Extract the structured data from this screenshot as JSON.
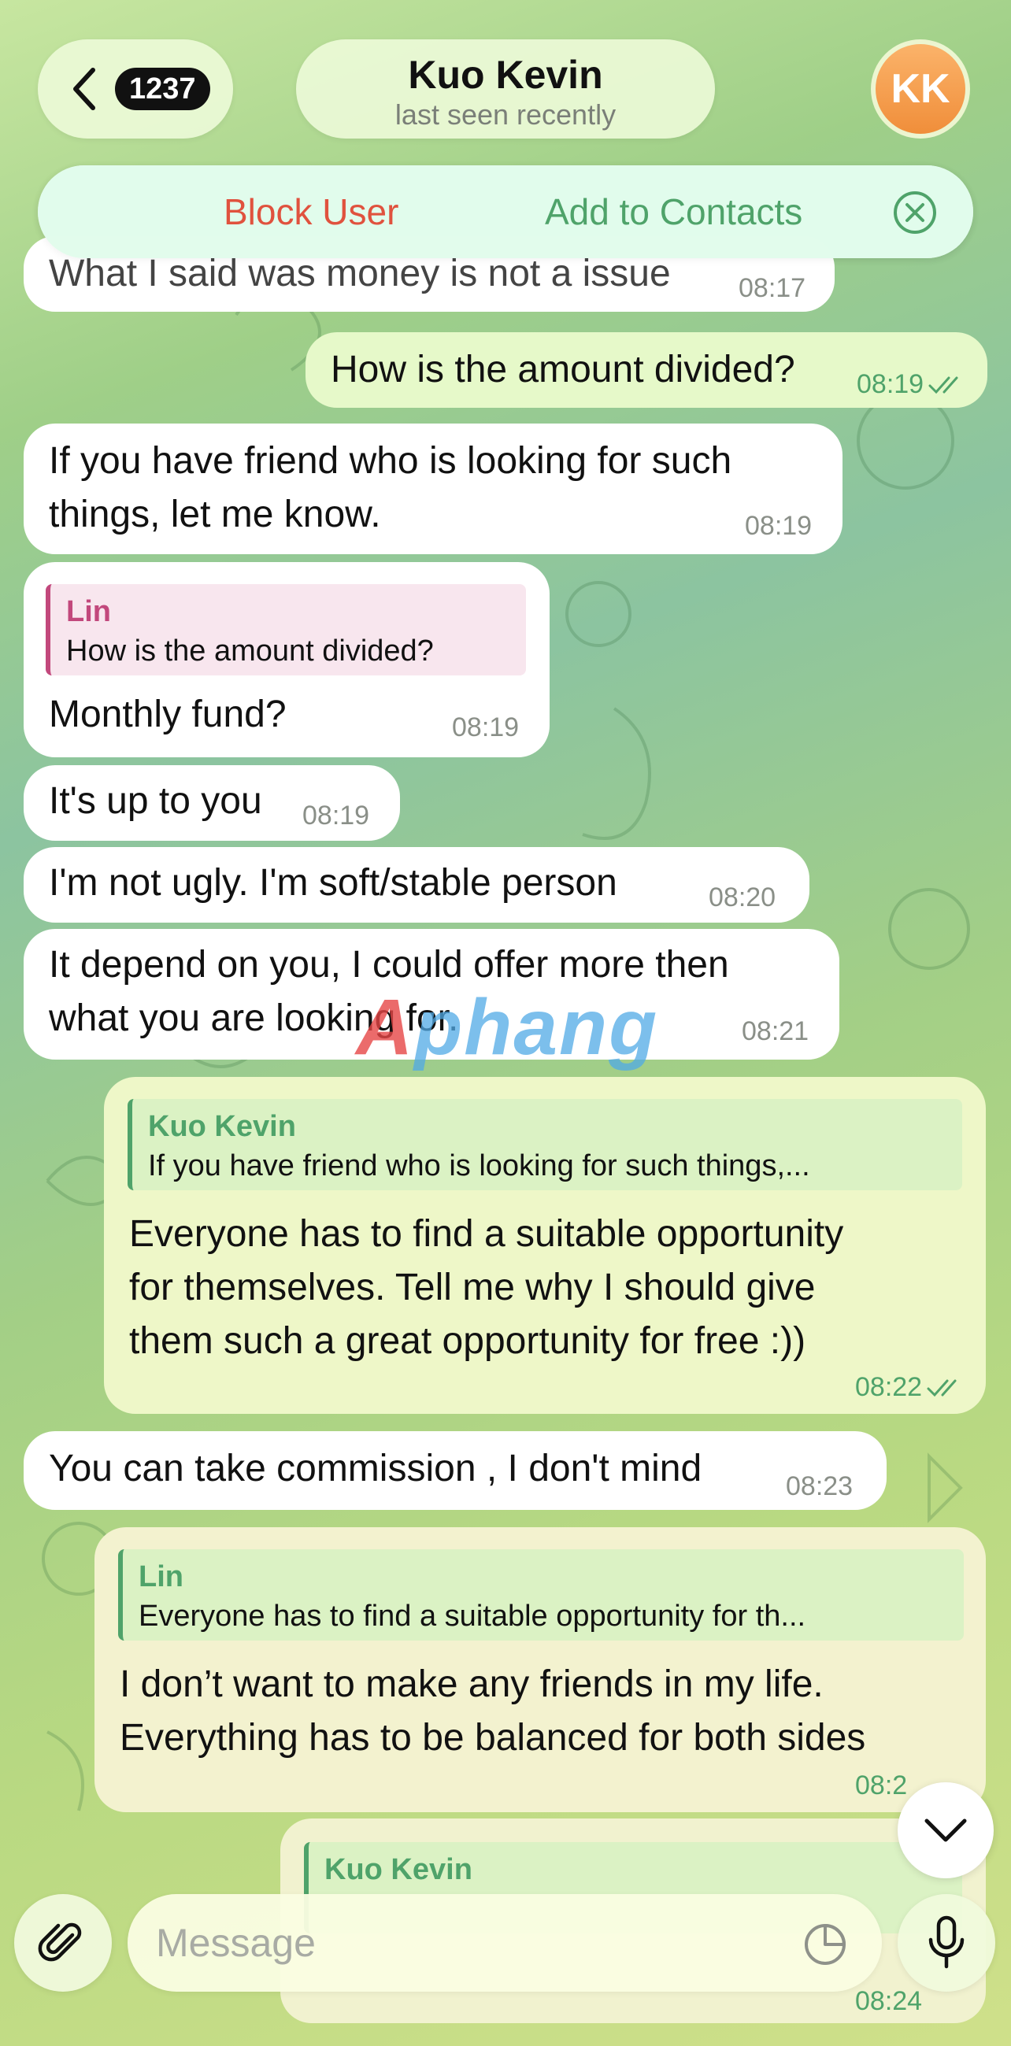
{
  "header": {
    "back_count": "1237",
    "contact_name": "Kuo Kevin",
    "status": "last seen recently",
    "avatar_initials": "KK"
  },
  "action_bar": {
    "block_label": "Block User",
    "add_label": "Add to Contacts"
  },
  "messages": [
    {
      "dir": "in",
      "text": "What I said was money is not a issue",
      "time": "08:17"
    },
    {
      "dir": "out",
      "text": "How is the amount divided?",
      "time": "08:19"
    },
    {
      "dir": "in",
      "text_line1": "If you have friend who is looking for such",
      "text_line2": "things, let me know.",
      "time": "08:19"
    },
    {
      "dir": "in",
      "reply_name": "Lin",
      "reply_text": "How is the amount divided?",
      "text": "Monthly fund?",
      "time": "08:19"
    },
    {
      "dir": "in",
      "text": "It's up to you",
      "time": "08:19"
    },
    {
      "dir": "in",
      "text": "I'm not ugly. I'm soft/stable person",
      "time": "08:20"
    },
    {
      "dir": "in",
      "text_line1": "It depend on you, I could offer more then",
      "text_line2": "what you are looking for.",
      "time": "08:21"
    },
    {
      "dir": "out",
      "reply_name": "Kuo Kevin",
      "reply_text": "If you have friend who is looking for such things,...",
      "text_line1": "Everyone has to find a suitable opportunity",
      "text_line2": "for themselves. Tell me why I should give",
      "text_line3": "them such a great opportunity for free :))",
      "time": "08:22"
    },
    {
      "dir": "in",
      "text": "You can take commission , I don't mind",
      "time": "08:23"
    },
    {
      "dir": "out",
      "reply_name": "Lin",
      "reply_text": "Everyone has to find a suitable opportunity for th...",
      "text_line1": "I don’t want to make any friends in my life.",
      "text_line2": "Everything has to be balanced for both sides",
      "time": "08:2"
    },
    {
      "dir": "out",
      "reply_name": "Kuo Kevin",
      "time": "08:24"
    }
  ],
  "input": {
    "placeholder": "Message"
  },
  "watermark": {
    "text_red": "A",
    "text_blue": "phang"
  },
  "colors": {
    "accent_green": "#4fa36a",
    "block_red": "#e0523e",
    "avatar_orange": "#f08e3a",
    "reply_pink": "#c2487c"
  }
}
